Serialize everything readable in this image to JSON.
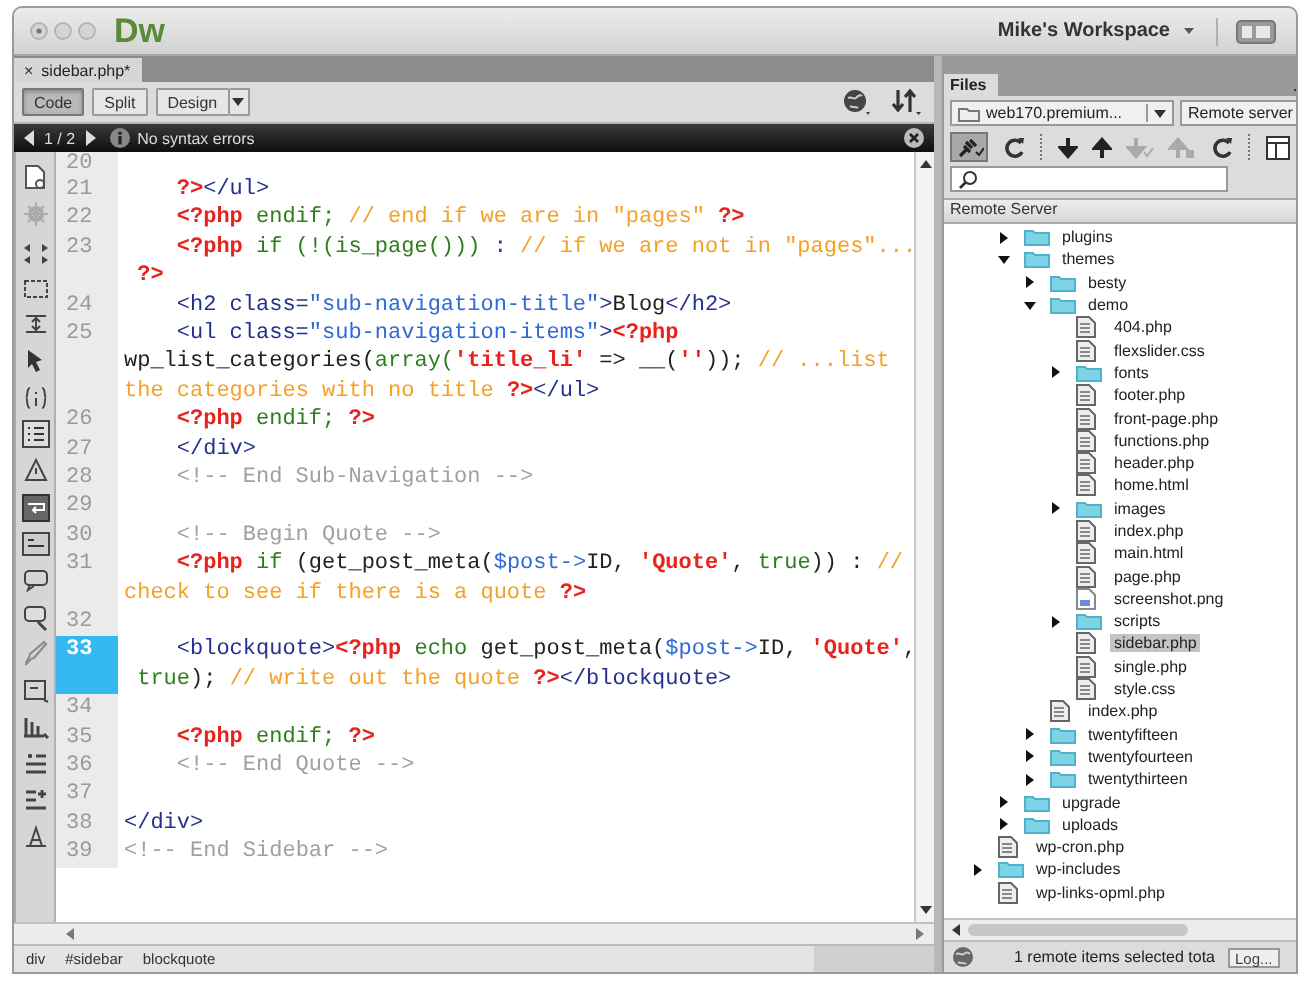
{
  "app": {
    "logo": "Dw",
    "workspace": "Mike's Workspace"
  },
  "document_tabs": [
    {
      "label": "sidebar.php*",
      "close": "×",
      "selected": true
    }
  ],
  "view_buttons": [
    {
      "label": "Code",
      "selected": true,
      "dropdown": false
    },
    {
      "label": "Split",
      "selected": false,
      "dropdown": false
    },
    {
      "label": "Design",
      "selected": false,
      "dropdown": true
    }
  ],
  "error_bar": {
    "page": "1 / 2",
    "message": "No syntax errors"
  },
  "editor": {
    "lines": [
      {
        "number": "20",
        "current": false
      },
      {
        "number": "21",
        "current": false,
        "rows": [
          {
            "indented": true,
            "leading_space": false,
            "tokens": [
              {
                "t": "?>",
                "kind": "php"
              },
              {
                "t": "</ul>",
                "kind": "tag"
              }
            ]
          }
        ]
      },
      {
        "number": "22",
        "current": false,
        "rows": [
          {
            "indented": true,
            "leading_space": false,
            "tokens": [
              {
                "t": "<?php",
                "kind": "php"
              },
              {
                "t": " endif; ",
                "kind": "kw"
              },
              {
                "t": "// end if we are in \"pages\" ",
                "kind": "cm"
              },
              {
                "t": "?>",
                "kind": "php"
              }
            ]
          }
        ]
      },
      {
        "number": "23",
        "current": false,
        "rows": [
          {
            "indented": true,
            "leading_space": false,
            "tokens": [
              {
                "t": "<?php",
                "kind": "php"
              },
              {
                "t": " if (!(is_page()))",
                "kind": "kw"
              },
              {
                "t": " : ",
                "kind": "tag"
              },
              {
                "t": "// if we are not in \"pages\"...",
                "kind": "cm"
              }
            ]
          },
          {
            "indented": false,
            "leading_space": true,
            "tokens": [
              {
                "t": "?>",
                "kind": "php"
              }
            ]
          }
        ]
      },
      {
        "number": "24",
        "current": false,
        "rows": [
          {
            "indented": true,
            "leading_space": false,
            "tokens": [
              {
                "t": "<h2 class=",
                "kind": "tag"
              },
              {
                "t": "\"sub-navigation-title\"",
                "kind": "val"
              },
              {
                "t": ">",
                "kind": "tag"
              },
              {
                "t": "Blog",
                "kind": "txt"
              },
              {
                "t": "</h2>",
                "kind": "tag"
              }
            ]
          }
        ]
      },
      {
        "number": "25",
        "current": false,
        "rows": [
          {
            "indented": true,
            "leading_space": false,
            "tokens": [
              {
                "t": "<ul class=",
                "kind": "tag"
              },
              {
                "t": "\"sub-navigation-items\"",
                "kind": "val"
              },
              {
                "t": ">",
                "kind": "tag"
              },
              {
                "t": "<?php",
                "kind": "php"
              }
            ]
          },
          {
            "indented": false,
            "leading_space": false,
            "tokens": [
              {
                "t": "wp_list_categories(",
                "kind": "txt"
              },
              {
                "t": "array(",
                "kind": "kw"
              },
              {
                "t": "'title_li'",
                "kind": "php"
              },
              {
                "t": " => __(",
                "kind": "txt"
              },
              {
                "t": "''",
                "kind": "php"
              },
              {
                "t": ")); ",
                "kind": "txt"
              },
              {
                "t": "// ...list",
                "kind": "cm"
              }
            ]
          },
          {
            "indented": false,
            "leading_space": false,
            "tokens": [
              {
                "t": "the categories with no title ",
                "kind": "cm"
              },
              {
                "t": "?>",
                "kind": "php"
              },
              {
                "t": "</ul>",
                "kind": "tag"
              }
            ]
          }
        ]
      },
      {
        "number": "26",
        "current": false,
        "rows": [
          {
            "indented": true,
            "leading_space": false,
            "tokens": [
              {
                "t": "<?php",
                "kind": "php"
              },
              {
                "t": " endif; ",
                "kind": "kw"
              },
              {
                "t": "?>",
                "kind": "php"
              }
            ]
          }
        ]
      },
      {
        "number": "27",
        "current": false,
        "rows": [
          {
            "indented": true,
            "leading_space": false,
            "tokens": [
              {
                "t": "</div>",
                "kind": "tag"
              }
            ]
          }
        ]
      },
      {
        "number": "28",
        "current": false,
        "rows": [
          {
            "indented": true,
            "leading_space": false,
            "tokens": [
              {
                "t": "<!-- End Sub-Navigation -->",
                "kind": "hc"
              }
            ]
          }
        ]
      },
      {
        "number": "29",
        "current": false
      },
      {
        "number": "30",
        "current": false,
        "rows": [
          {
            "indented": true,
            "leading_space": false,
            "tokens": [
              {
                "t": "<!-- Begin Quote -->",
                "kind": "hc"
              }
            ]
          }
        ]
      },
      {
        "number": "31",
        "current": false,
        "rows": [
          {
            "indented": true,
            "leading_space": false,
            "tokens": [
              {
                "t": "<?php",
                "kind": "php"
              },
              {
                "t": " if",
                "kind": "kw"
              },
              {
                "t": " (get_post_meta(",
                "kind": "txt"
              },
              {
                "t": "$post->",
                "kind": "var"
              },
              {
                "t": "ID, ",
                "kind": "txt"
              },
              {
                "t": "'Quote'",
                "kind": "php"
              },
              {
                "t": ", ",
                "kind": "txt"
              },
              {
                "t": "true",
                "kind": "kw"
              },
              {
                "t": ")) : ",
                "kind": "txt"
              },
              {
                "t": "//",
                "kind": "cm"
              }
            ]
          },
          {
            "indented": false,
            "leading_space": false,
            "tokens": [
              {
                "t": "check to see if there is a quote ",
                "kind": "cm"
              },
              {
                "t": "?>",
                "kind": "php"
              }
            ]
          }
        ]
      },
      {
        "number": "32",
        "current": false
      },
      {
        "number": "33",
        "current": true,
        "rows": [
          {
            "indented": true,
            "leading_space": false,
            "tokens": [
              {
                "t": "<blockquote>",
                "kind": "tag"
              },
              {
                "t": "<?php",
                "kind": "php"
              },
              {
                "t": " echo",
                "kind": "kw"
              },
              {
                "t": " get_post_meta(",
                "kind": "txt"
              },
              {
                "t": "$post->",
                "kind": "var"
              },
              {
                "t": "ID, ",
                "kind": "txt"
              },
              {
                "t": "'Quote'",
                "kind": "php"
              },
              {
                "t": ",",
                "kind": "txt"
              }
            ]
          },
          {
            "indented": false,
            "leading_space": true,
            "tokens": [
              {
                "t": "true",
                "kind": "kw"
              },
              {
                "t": "); ",
                "kind": "txt"
              },
              {
                "t": "// write out the quote ",
                "kind": "cm"
              },
              {
                "t": "?>",
                "kind": "php"
              },
              {
                "t": "</blockquote>",
                "kind": "tag"
              }
            ]
          }
        ]
      },
      {
        "number": "34",
        "current": false
      },
      {
        "number": "35",
        "current": false,
        "rows": [
          {
            "indented": true,
            "leading_space": false,
            "tokens": [
              {
                "t": "<?php",
                "kind": "php"
              },
              {
                "t": " endif; ",
                "kind": "kw"
              },
              {
                "t": "?>",
                "kind": "php"
              }
            ]
          }
        ]
      },
      {
        "number": "36",
        "current": false,
        "rows": [
          {
            "indented": true,
            "leading_space": false,
            "tokens": [
              {
                "t": "<!-- End Quote -->",
                "kind": "hc"
              }
            ]
          }
        ]
      },
      {
        "number": "37",
        "current": false
      },
      {
        "number": "38",
        "current": false,
        "rows": [
          {
            "indented": false,
            "leading_space": false,
            "tokens": [
              {
                "t": "</div>",
                "kind": "tag"
              }
            ]
          }
        ]
      },
      {
        "number": "39",
        "current": false,
        "rows": [
          {
            "indented": false,
            "leading_space": false,
            "tokens": [
              {
                "t": "<!-- End Sidebar -->",
                "kind": "hc"
              }
            ]
          }
        ]
      }
    ]
  },
  "tag_selector": [
    "div",
    "#sidebar",
    "blockquote"
  ],
  "files_panel": {
    "tab": "Files",
    "site": "web170.premium...",
    "server": "Remote server",
    "column": "Remote Server",
    "tree": [
      {
        "children": [
          {
            "label": "plugins",
            "kind": "folder",
            "expanded": false,
            "selected": false
          },
          {
            "label": "themes",
            "kind": "folder",
            "expanded": true,
            "selected": false,
            "children": [
              {
                "label": "besty",
                "kind": "folder",
                "expanded": false,
                "selected": false
              },
              {
                "label": "demo",
                "kind": "folder",
                "expanded": true,
                "selected": false,
                "children": [
                  {
                    "label": "404.php",
                    "kind": "file",
                    "selected": false
                  },
                  {
                    "label": "flexslider.css",
                    "kind": "file",
                    "selected": false
                  },
                  {
                    "label": "fonts",
                    "kind": "folder",
                    "expanded": false,
                    "selected": false
                  },
                  {
                    "label": "footer.php",
                    "kind": "file",
                    "selected": false
                  },
                  {
                    "label": "front-page.php",
                    "kind": "file",
                    "selected": false
                  },
                  {
                    "label": "functions.php",
                    "kind": "file",
                    "selected": false
                  },
                  {
                    "label": "header.php",
                    "kind": "file",
                    "selected": false
                  },
                  {
                    "label": "home.html",
                    "kind": "file",
                    "selected": false
                  },
                  {
                    "label": "images",
                    "kind": "folder",
                    "expanded": false,
                    "selected": false
                  },
                  {
                    "label": "index.php",
                    "kind": "file",
                    "selected": false
                  },
                  {
                    "label": "main.html",
                    "kind": "file",
                    "selected": false
                  },
                  {
                    "label": "page.php",
                    "kind": "file",
                    "selected": false
                  },
                  {
                    "label": "screenshot.png",
                    "kind": "image",
                    "selected": false
                  },
                  {
                    "label": "scripts",
                    "kind": "folder",
                    "expanded": false,
                    "selected": false
                  },
                  {
                    "label": "sidebar.php",
                    "kind": "file",
                    "selected": true
                  },
                  {
                    "label": "single.php",
                    "kind": "file",
                    "selected": false
                  },
                  {
                    "label": "style.css",
                    "kind": "file",
                    "selected": false
                  }
                ]
              },
              {
                "label": "index.php",
                "kind": "file",
                "selected": false
              },
              {
                "label": "twentyfifteen",
                "kind": "folder",
                "expanded": false,
                "selected": false
              },
              {
                "label": "twentyfourteen",
                "kind": "folder",
                "expanded": false,
                "selected": false
              },
              {
                "label": "twentythirteen",
                "kind": "folder",
                "expanded": false,
                "selected": false
              }
            ]
          },
          {
            "label": "upgrade",
            "kind": "folder",
            "expanded": false,
            "selected": false
          },
          {
            "label": "uploads",
            "kind": "folder",
            "expanded": false,
            "selected": false
          }
        ]
      },
      {
        "label": "wp-cron.php",
        "kind": "file",
        "selected": false
      },
      {
        "label": "wp-includes",
        "kind": "folder",
        "expanded": false,
        "selected": false
      },
      {
        "label": "wp-links-opml.php",
        "kind": "file",
        "selected": false
      }
    ],
    "status": "1 remote items selected tota",
    "log_button": "Log..."
  }
}
